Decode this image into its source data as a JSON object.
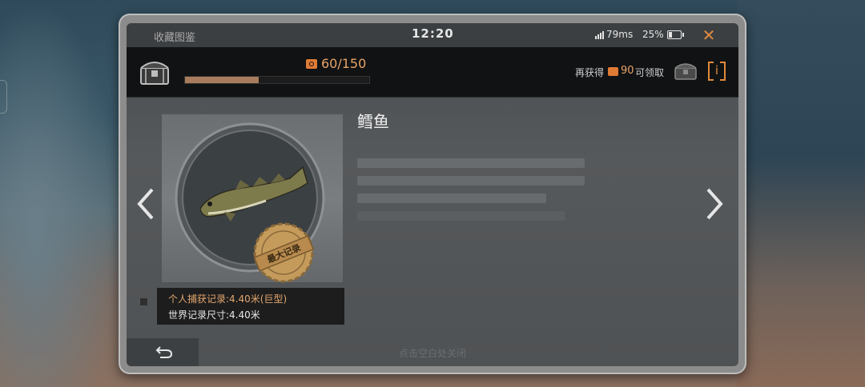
{
  "status_bar": {
    "title": "收藏图鉴",
    "time": "12:20",
    "ping": "79ms",
    "battery": "25%",
    "battery_level": 0.25
  },
  "header": {
    "progress_text": "60/150",
    "progress_fraction": 0.4,
    "claim_prefix": "再获得",
    "claim_count": "90",
    "claim_suffix": "可领取"
  },
  "fish": {
    "name": "鳕鱼",
    "medal_label": "最大记录",
    "personal_record": "个人捕获记录:4.40米(巨型)",
    "world_record": "世界记录尺寸:4.40米"
  },
  "footer": {
    "hint": "点击空白处关闭"
  },
  "colors": {
    "accent_orange": "#e08a3c",
    "progress_fill": "#a87c5c",
    "record_text": "#e3a66d"
  },
  "icons": [
    "close-icon",
    "chest-icon",
    "coin-icon",
    "info-icon",
    "chevron-left-icon",
    "chevron-right-icon",
    "back-icon",
    "medal-icon",
    "signal-icon",
    "battery-icon"
  ]
}
